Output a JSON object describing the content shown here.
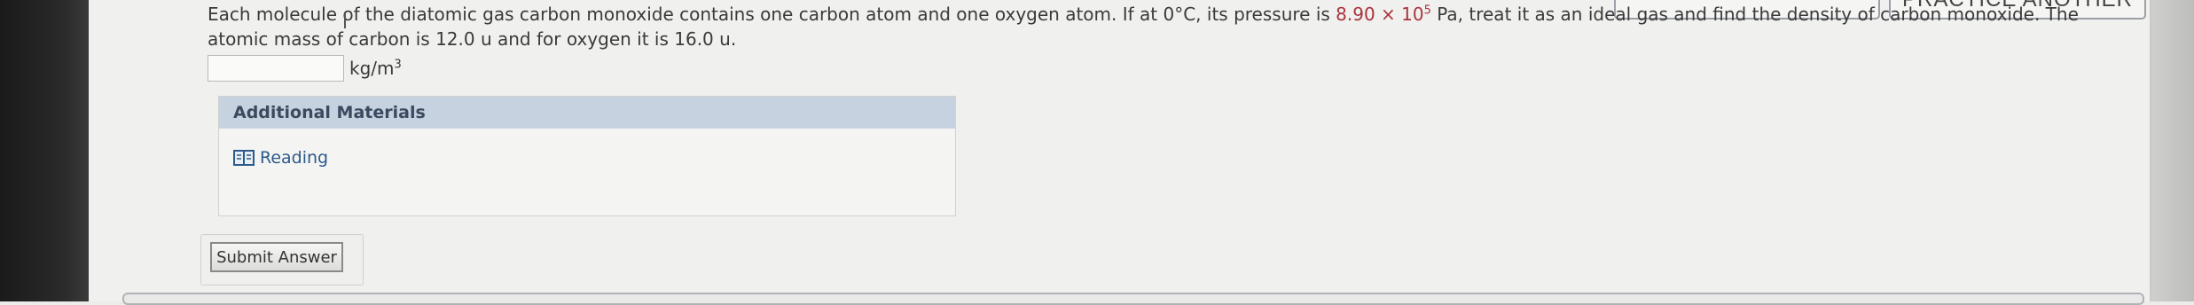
{
  "top_buttons": [
    {
      "label": ""
    },
    {
      "label": "PRACTICE ANOTHER"
    }
  ],
  "question": {
    "text_part1": "Each molecule of the diatomic gas carbon monoxide contains one carbon atom and one oxygen atom. If at 0°C, its pressure is ",
    "pressure_mantissa": "8.90 × 10",
    "pressure_exponent": "5",
    "text_part2": " Pa, treat it as an ideal gas and find the density of carbon monoxide. The atomic mass of carbon is 12.0 u and for oxygen it is 16.0 u."
  },
  "answer": {
    "value": "",
    "unit_base": "kg/m",
    "unit_exponent": "3"
  },
  "materials": {
    "header": "Additional Materials",
    "reading_label": "Reading"
  },
  "submit": {
    "label": "Submit Answer"
  },
  "colors": {
    "highlight": "#a9343c",
    "header_bg": "#c6d2e0",
    "link": "#2d5a8a"
  }
}
